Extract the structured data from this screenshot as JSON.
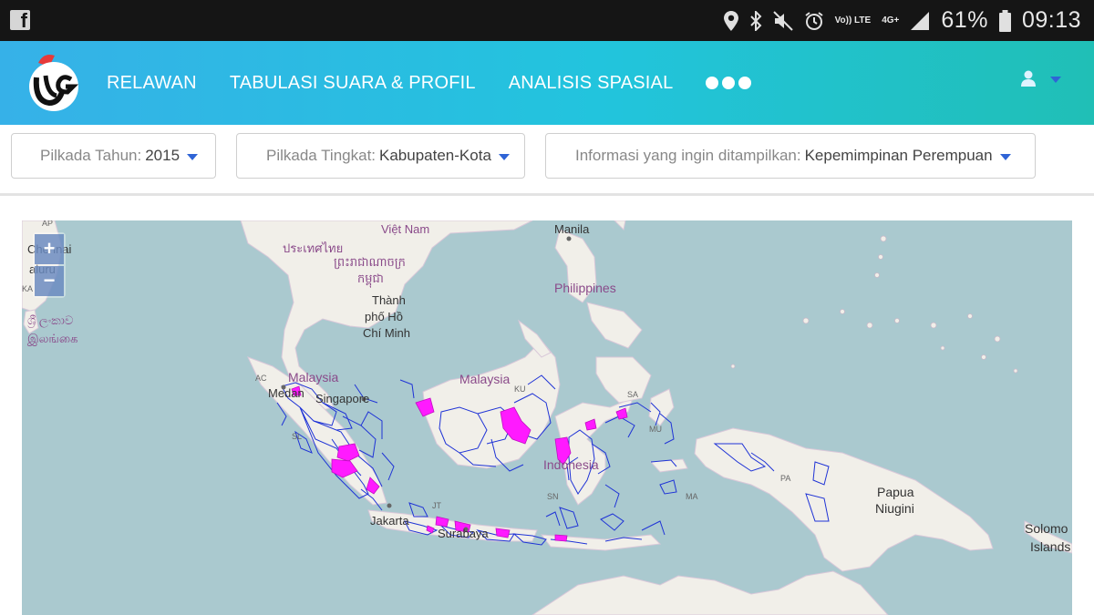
{
  "status_bar": {
    "left_app_icon": "facebook-icon",
    "icons": [
      "location-icon",
      "bluetooth-icon",
      "mute-icon",
      "alarm-icon",
      "volte-icon",
      "network-4g-icon",
      "signal-icon"
    ],
    "volte_label": "Vo)) LTE",
    "network_label": "4G+",
    "battery_percent": "61%",
    "time": "09:13"
  },
  "header": {
    "logo_icon": "wg-logo",
    "nav": [
      "RELAWAN",
      "TABULASI SUARA & PROFIL",
      "ANALISIS SPASIAL"
    ],
    "more_icon": "more-dots-icon",
    "user_icon": "user-icon"
  },
  "filters": [
    {
      "label": "Pilkada Tahun:",
      "value": "2015"
    },
    {
      "label": "Pilkada Tingkat:",
      "value": "Kabupaten-Kota"
    },
    {
      "label": "Informasi yang ingin ditampilkan:",
      "value": "Kepemimpinan Perempuan"
    }
  ],
  "map": {
    "zoom_in": "+",
    "zoom_out": "−",
    "labels": {
      "chennai": "Chennai",
      "maluru": "aluru",
      "ap": "AP",
      "ka": "KA",
      "srilanka_si": "ශ්‍රී ලංකාව",
      "srilanka_ta": "இலங்கை",
      "thailand": "ประเทศไทย",
      "cambodia1": "ព្រះរាជាណាចក្រ",
      "cambodia2": "កម្ពុជា",
      "vietnam": "Việt Nam",
      "hcm1": "Thành",
      "hcm2": "phố Hồ",
      "hcm3": "Chí Minh",
      "manila": "Manila",
      "philippines": "Philippines",
      "malaysia_w": "Malaysia",
      "malaysia_e": "Malaysia",
      "medan": "Medan",
      "singapore": "Singapore",
      "indonesia": "Indonesia",
      "jakarta": "Jakarta",
      "surabaya": "Surabaya",
      "papua": "Papua",
      "niugini": "Niugini",
      "solomon": "Solomo",
      "islands": "Islands",
      "ac": "AC",
      "ku": "KU",
      "sa": "SA",
      "mu": "MU",
      "pa": "PA",
      "ma": "MA",
      "sn": "SN",
      "jt": "JT",
      "sl": "SL"
    },
    "colors": {
      "water": "#aac9cf",
      "land": "#f1efe9",
      "region_border": "#1f33d6",
      "highlight": "#ff1aff"
    }
  }
}
